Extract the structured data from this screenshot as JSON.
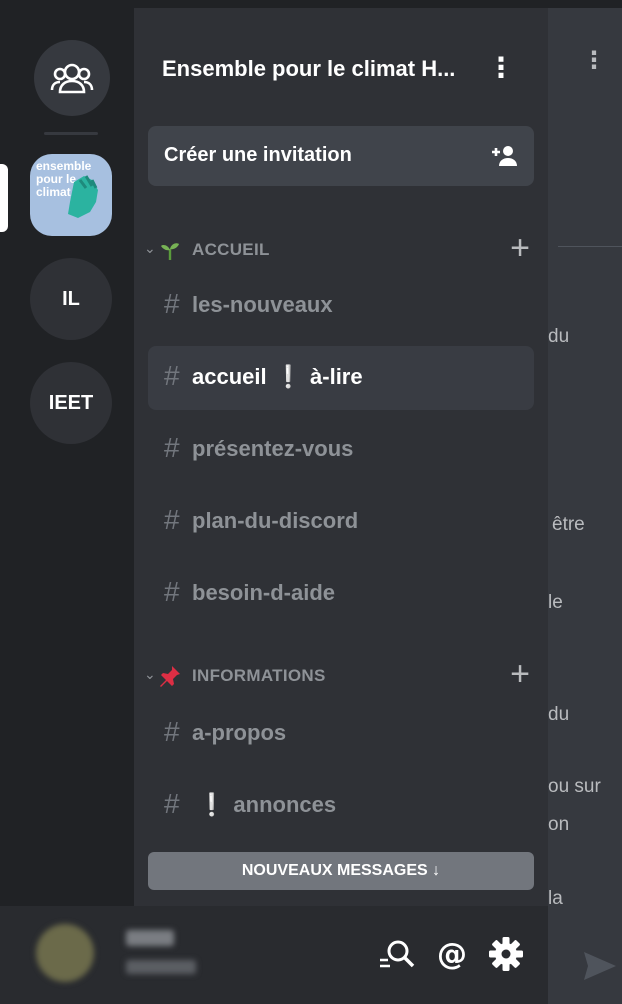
{
  "server": {
    "name": "Ensemble pour le climat H...",
    "logo_text": "ensemble pour le climat",
    "others": [
      "IL",
      "IEET"
    ]
  },
  "invite": {
    "label": "Créer une invitation"
  },
  "categories": [
    {
      "name": "ACCUEIL",
      "emoji": "seedling-icon",
      "channels": [
        "les-nouveaux",
        "accueil",
        "à-lire",
        "présentez-vous",
        "plan-du-discord",
        "besoin-d-aide"
      ]
    },
    {
      "name": "INFORMATIONS",
      "emoji": "pushpin-icon",
      "channels": [
        "a-propos",
        "annonces"
      ]
    }
  ],
  "active_channel": "accueil ❕ à-lire",
  "new_messages": "NOUVEAUX MESSAGES ↓",
  "background_snippets": [
    "du",
    "être",
    "le",
    "du",
    "ou sur",
    "on",
    "la"
  ],
  "userbar": {
    "icons": [
      "search-icon",
      "mention-icon",
      "settings-icon"
    ]
  },
  "colors": {
    "accent": "#00b0f4",
    "sidebar": "#2f3136",
    "rail": "#202225",
    "active": "#393c43"
  }
}
